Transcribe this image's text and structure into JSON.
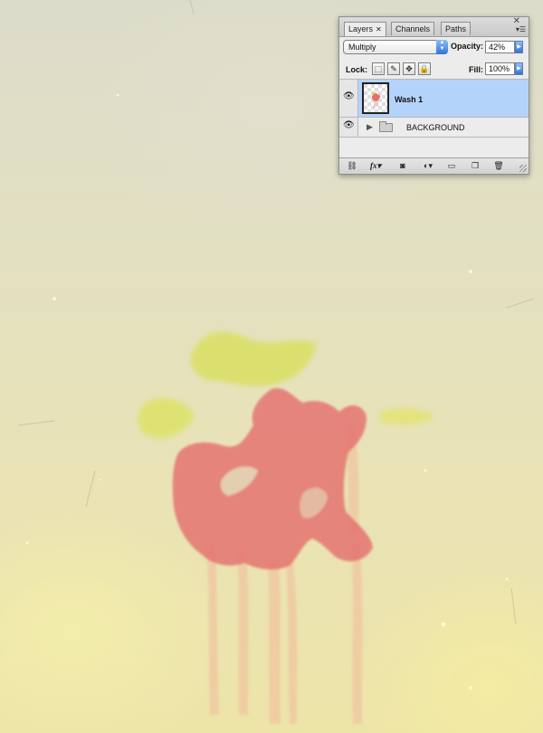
{
  "panel": {
    "tabs": [
      {
        "label": "Layers",
        "active": true
      },
      {
        "label": "Channels",
        "active": false
      },
      {
        "label": "Paths",
        "active": false
      }
    ],
    "blend_mode": "Multiply",
    "opacity_label": "Opacity:",
    "opacity_value": "42%",
    "lock_label": "Lock:",
    "fill_label": "Fill:",
    "fill_value": "100%",
    "layers": [
      {
        "name": "Wash 1",
        "visible": true,
        "selected": true
      },
      {
        "name": "BACKGROUND",
        "visible": true,
        "selected": false,
        "type": "group"
      }
    ],
    "footer_buttons": [
      "link-layers-icon",
      "fx-icon",
      "add-mask-icon",
      "adjustment-layer-icon",
      "new-group-icon",
      "new-layer-icon",
      "trash-icon"
    ],
    "fx_label": "fx",
    "colors": {
      "selection": "#b4d3fb",
      "panel_bg": "#ececec",
      "accent": "#2f73d8"
    }
  },
  "canvas": {
    "colors": {
      "paper": "#e3e0c1",
      "wash_red": "#e56d6d",
      "wash_yellow": "#d8df55",
      "drip": "#f0c8a0"
    }
  }
}
